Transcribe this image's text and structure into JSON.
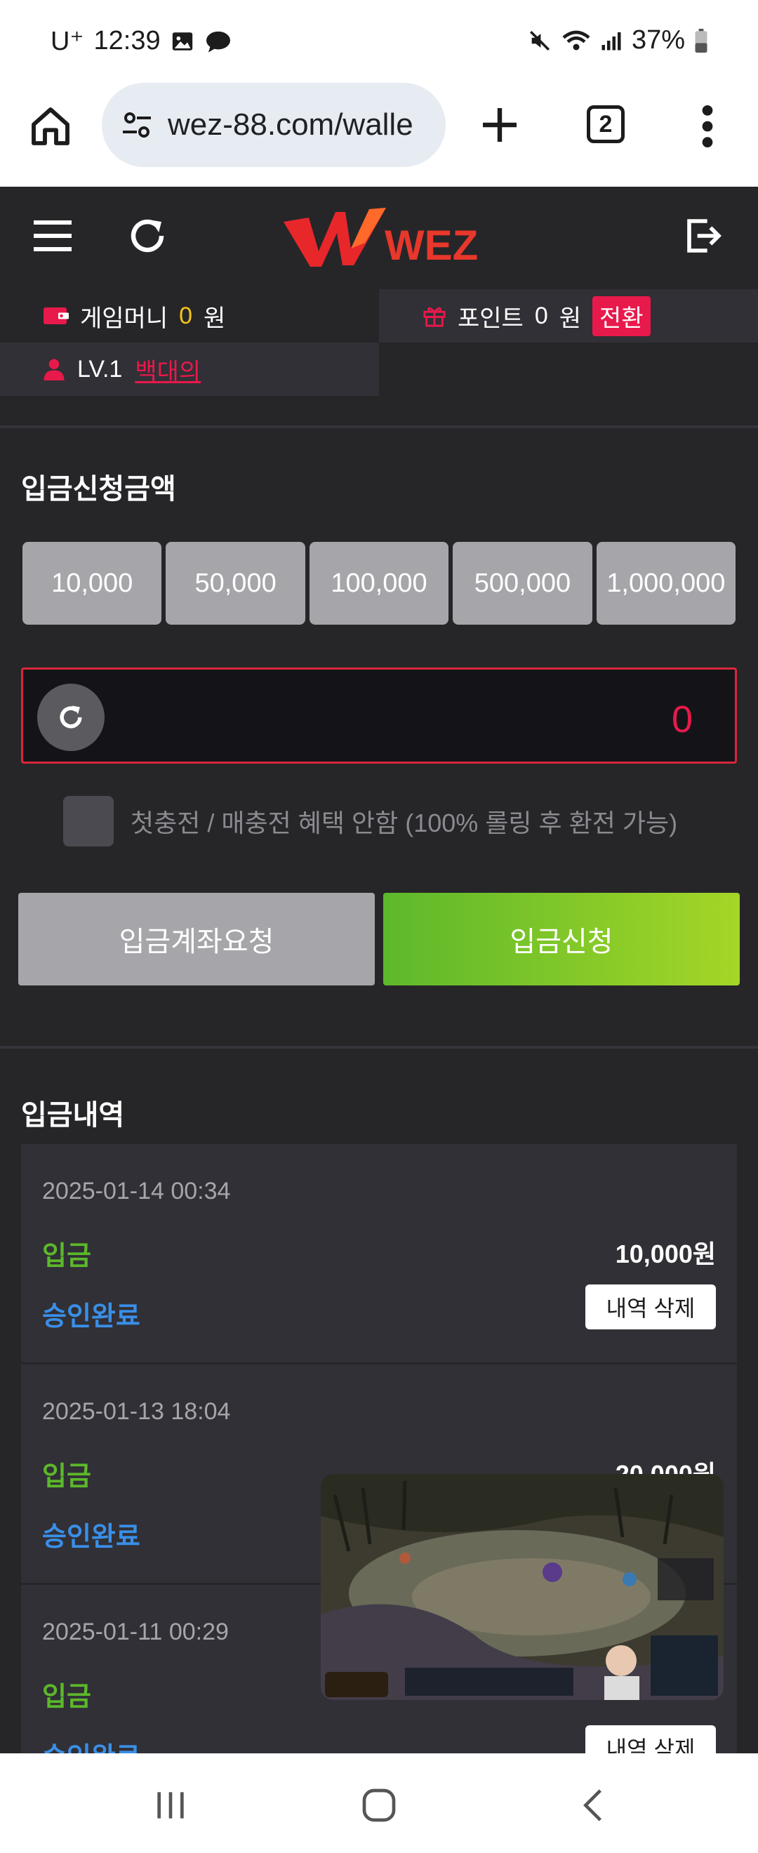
{
  "status_bar": {
    "carrier": "U⁺",
    "time": "12:39",
    "battery": "37%"
  },
  "browser": {
    "url": "wez-88.com/walle",
    "tab_count": "2"
  },
  "header": {
    "logo_text": "WEZ"
  },
  "account": {
    "game_money_label": "게임머니",
    "game_money_value": "0",
    "won": "원",
    "points_label": "포인트",
    "points_value": "0",
    "convert_label": "전환",
    "level": "LV.1",
    "username": "백대의"
  },
  "deposit": {
    "title": "입금신청금액",
    "amounts": [
      "10,000",
      "50,000",
      "100,000",
      "500,000",
      "1,000,000"
    ],
    "amount_value": "0",
    "no_bonus_label": "첫충전 / 매충전 혜택 안함 (100% 롤링 후 환전 가능)",
    "account_request_button": "입금계좌요청",
    "submit_button": "입금신청"
  },
  "history": {
    "title": "입금내역",
    "delete_label": "내역 삭제",
    "rows": [
      {
        "date": "2025-01-14 00:34",
        "type": "입금",
        "amount": "10,000원",
        "status": "승인완료"
      },
      {
        "date": "2025-01-13 18:04",
        "type": "입금",
        "amount": "20,000원",
        "status": "승인완료"
      },
      {
        "date": "2025-01-11 00:29",
        "type": "입금",
        "amount": "",
        "status": "승인완료"
      }
    ]
  },
  "colors": {
    "accent_red": "#e8194b",
    "green": "#5db82b",
    "blue": "#3a8fe8",
    "bg": "#262629"
  }
}
